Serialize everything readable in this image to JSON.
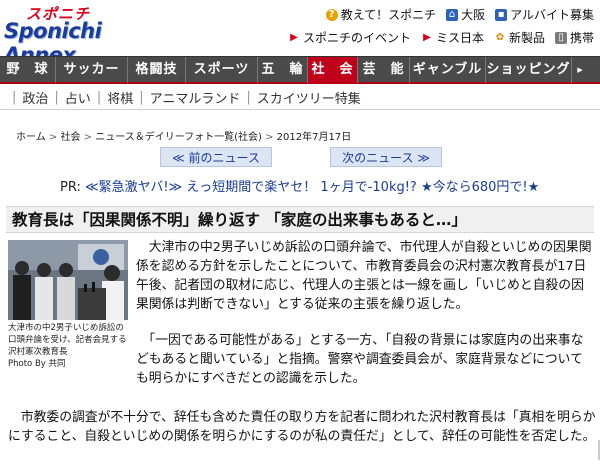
{
  "site": {
    "logo_top": "スポニチ",
    "logo_bottom": "Sponichi Annex"
  },
  "header": {
    "links_row1": [
      {
        "icon": "question-icon",
        "label": "教えて！スポニチ"
      },
      {
        "icon": "home-icon",
        "label": "大阪"
      },
      {
        "icon": "bag-icon",
        "label": "アルバイト募集"
      }
    ],
    "links_row2": [
      {
        "icon": "arrow-icon",
        "label": "スポニチのイベント"
      },
      {
        "icon": "arrow-icon",
        "label": "ミス日本"
      },
      {
        "icon": "flower-icon",
        "label": "新製品"
      },
      {
        "icon": "phone-icon",
        "label": "携帯"
      }
    ]
  },
  "nav": {
    "items": [
      "野　球",
      "サッカー",
      "格闘技",
      "スポーツ",
      "五　輪",
      "社　会",
      "芸　能",
      "ギャンブル",
      "ショッピング"
    ],
    "active_index": 5
  },
  "subnav": {
    "items": [
      "政治",
      "占い",
      "将棋",
      "アニマルランド",
      "スカイツリー特集"
    ]
  },
  "breadcrumb": {
    "home": "ホーム",
    "section": "社会",
    "list": "ニュース＆デイリーフォト一覧(社会)",
    "date": "2012年7月17日"
  },
  "pager": {
    "prev": "≪ 前のニュース",
    "next": "次のニュース ≫"
  },
  "pr": {
    "label": "PR:",
    "text": "≪緊急激ヤバ!≫ えっ短期間で楽ヤセ！ 1ヶ月で-10kg!? ★今なら680円で!★"
  },
  "article": {
    "headline": "教育長は「因果関係不明」繰り返す 「家庭の出来事もあると…」",
    "photo_caption": "大津市の中2男子いじめ訴訟の口頭弁論を受け、記者会見する沢村憲次教育長",
    "photo_credit": "Photo By 共同",
    "paragraphs": [
      "　大津市の中2男子いじめ訴訟の口頭弁論で、市代理人が自殺といじめの因果関係を認める方針を示したことについて、市教育委員会の沢村憲次教育長が17日午後、記者団の取材に応じ、代理人の主張とは一線を画し「いじめと自殺の因果関係は判断できない」とする従来の主張を繰り返した。",
      "　「一因である可能性がある」とする一方、「自殺の背景には家庭内の出来事などもあると聞いている」と指摘。警察や調査委員会が、家庭背景などについても明らかにすべきだとの認識を示した。",
      "　市教委の調査が不十分で、辞任も含めた責任の取り方を記者に問われた沢村教育長は「真相を明らかにすること、自殺といじめの関係を明らかにするのが私の責任だ」として、辞任の可能性を否定した。"
    ]
  },
  "colors": {
    "nav_bg": "#4a4a4a",
    "nav_active": "#c0001a",
    "link_blue": "#1a3d9a",
    "pager_bg": "#dce5f3"
  }
}
